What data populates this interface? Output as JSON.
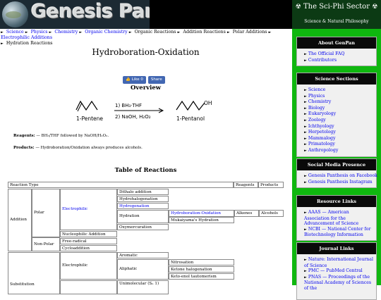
{
  "header": {
    "logo_text": "Genesis Panthesis",
    "sector_title_left": "The",
    "sector_title": "Sci-Phi",
    "sector_title_right": "Sector",
    "sector_sub": "Science & Natural Philosophy",
    "atom_icon": "☢"
  },
  "breadcrumb": {
    "items": [
      "Science",
      "Physics",
      "Chemistry",
      "Organic Chemistry",
      "Organic Reactions",
      "Addition Reactions",
      "Polar Additions",
      "Electrophilic Additions",
      "Hydration Reactions"
    ],
    "sep": "►"
  },
  "page": {
    "title": "Hydroboration-Oxidation",
    "like_label": "Like 0",
    "share_label": "Share",
    "overview_heading": "Overview",
    "figure": {
      "reactant": "1-Pentene",
      "step1": "1) BH₃·THF",
      "step2": "2) NaOH, H₂O₂",
      "product": "1-Pentanol",
      "oh": "OH"
    },
    "reagents_label": "Reagents:",
    "reagents_text": "— BH₃/THF followed by NaOH/H₂O₂.",
    "products_label": "Products:",
    "products_text": "— Hydroboration/Oxidation always produces alcohols.",
    "table_heading": "Table of Reactions"
  },
  "reaction_table": {
    "reaction_type": "Reaction Type",
    "reagents": "Reagents",
    "products": "Products",
    "addition": "Addition",
    "polar": "Polar",
    "electrophilic": "Electrophilic",
    "dithalo": "Dithalo addition",
    "hydrohalogenation": "Hydrohalogenation",
    "hydrogenation": "Hydrogenation",
    "hydration": "Hydration",
    "hydroboration": "Hydroboration-Oxidation",
    "mukaiyama": "Mukaiyama's Hydration",
    "alkenes": "Alkenes",
    "alcohols": "Alcohols",
    "oxymercuration": "Oxymercuration",
    "nucleophilic": "Nucleophilic Addition",
    "non_polar": "Non-Polar",
    "free_radical": "Free-radical",
    "cycloaddition": "Cycloaddition",
    "electrophilic2": "Electrophilic",
    "aromatic": "Aromatic",
    "aliphatic": "Aliphatic",
    "nitrosation": "Nitrosation",
    "ketone_halogenation": "Ketone halogenation",
    "keto_enol": "Keto-enol tautomerism",
    "substitution": "Substitution",
    "partial_last": "Unimolecular (Sₙ 1)"
  },
  "sidebar": {
    "about": {
      "title": "About GenPan",
      "items": [
        "The Official FAQ",
        "Contributors"
      ]
    },
    "science": {
      "title": "Science Sections",
      "items": [
        "Science",
        "Physics",
        "Chemistry",
        "Biology",
        "Eukaryology",
        "Zoology",
        "Ichthyology",
        "Herpetology",
        "Mammalogy",
        "Primatology",
        "Anthropology"
      ]
    },
    "social": {
      "title": "Social Media Presence",
      "items": [
        "Genesis Panthesis on Facebook",
        "Genesis Panthesis Instagram"
      ]
    },
    "resources": {
      "title": "Resource Links",
      "items": [
        "AAAS — American Association for the Advancement of Science",
        "NCBI — National Center for Biotechnology Information"
      ]
    },
    "journals": {
      "title": "Journal Links",
      "items": [
        "Nature: International Journal of Science",
        "PMC — PubMed Central",
        "PNAS — Proceedings of the National Academy of Sciences of the"
      ]
    }
  },
  "colors": {
    "sidebar": "#0fb70f",
    "link": "#0000ee",
    "header": "#000000"
  }
}
